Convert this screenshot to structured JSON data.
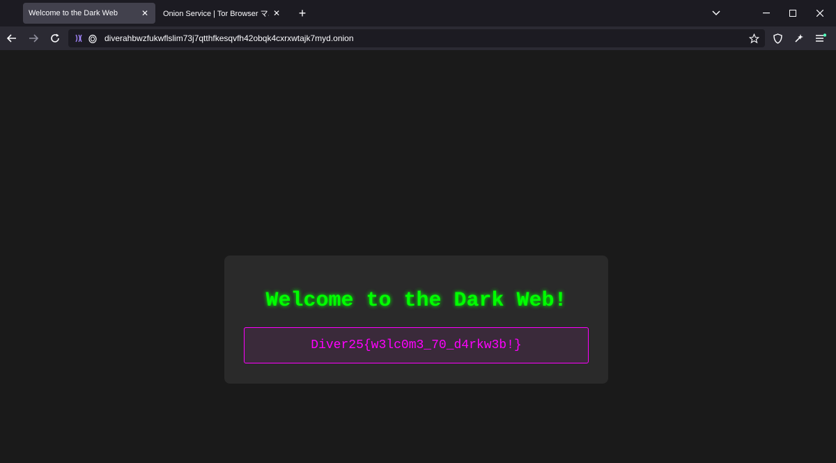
{
  "browser": {
    "tabs": [
      {
        "title": "Welcome to the Dark Web",
        "active": true
      },
      {
        "title": "Onion Service | Tor Browser マニュ",
        "active": false
      }
    ],
    "url": "diverahbwzfukwflslim73j7qtthfkesqvfh42obqk4cxrxwtajk7myd.onion",
    "icons": {
      "back": "back-arrow-icon",
      "forward": "forward-arrow-icon",
      "reload": "reload-icon",
      "onion_circuit": "onion-circuit-icon",
      "security": "lock-icon",
      "bookmark": "star-icon",
      "shield": "shield-icon",
      "new_identity": "broom-icon",
      "menu": "hamburger-menu-icon"
    }
  },
  "page": {
    "heading": "Welcome to the Dark Web!",
    "flag": "Diver25{w3lc0m3_70_d4rkw3b!}"
  },
  "colors": {
    "heading": "#00ff00",
    "flag_text": "#ff00ff",
    "flag_border": "#ff00ff",
    "card_background": "#2a2a2a",
    "page_background": "#1a1a1a"
  }
}
